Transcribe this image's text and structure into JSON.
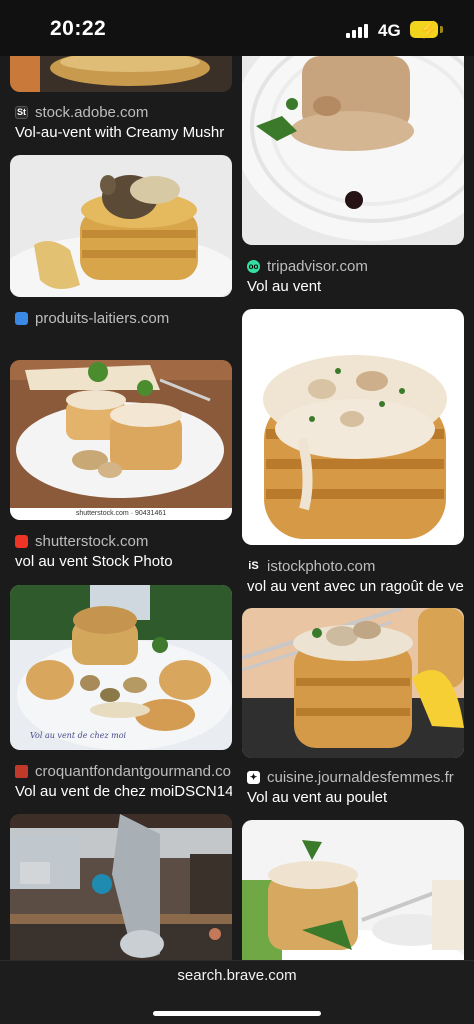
{
  "status_bar": {
    "time": "20:22",
    "network": "4G"
  },
  "results": [
    {
      "source": "stock.adobe.com",
      "title": "Vol-au-vent with Creamy Mushr",
      "favicon": "adobe-stock-icon",
      "favicon_text": "St",
      "favicon_color": "#2b2b2b"
    },
    {
      "source": "tripadvisor.com",
      "title": "Vol au vent",
      "favicon": "tripadvisor-owl-icon",
      "favicon_text": "oo",
      "favicon_color": "#34e0a1"
    },
    {
      "source": "produits-laitiers.com",
      "title": "",
      "favicon": "produits-laitiers-icon",
      "favicon_text": "",
      "favicon_color": "#3b88e6"
    },
    {
      "source": "shutterstock.com",
      "title": "vol au vent Stock Photo",
      "favicon": "shutterstock-icon",
      "favicon_text": "",
      "favicon_color": "#ee3424",
      "watermark": "shutterstock.com · 90431461"
    },
    {
      "source": "istockphoto.com",
      "title": "vol au vent avec un ragoût de ve",
      "favicon": "istock-icon",
      "favicon_text": "iS",
      "favicon_color": "#1b1b1b"
    },
    {
      "source": "croquantfondantgourmand.co",
      "title": "Vol au vent de chez moiDSCN14",
      "favicon": "croquant-fondant-icon",
      "favicon_text": "",
      "favicon_color": "#c0392b",
      "caption": "Vol au vent de chez moi"
    },
    {
      "source": "cuisine.journaldesfemmes.fr",
      "title": "Vol au vent au poulet",
      "favicon": "journal-des-femmes-icon",
      "favicon_text": "",
      "favicon_color": "#ffffff"
    }
  ],
  "url_bar": {
    "url": "search.brave.com"
  }
}
